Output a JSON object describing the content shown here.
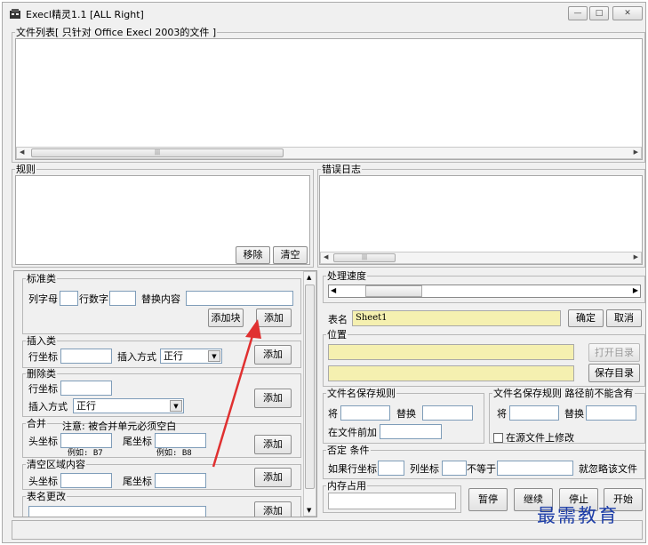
{
  "window": {
    "title": "Execl精灵1.1  [ALL Right]",
    "minimize_label": "—",
    "maximize_label": "□",
    "close_label": "✕"
  },
  "file_list": {
    "legend": "文件列表[ 只针对 Office Execl 2003的文件 ]"
  },
  "rules": {
    "legend": "规则",
    "remove_label": "移除",
    "clear_label": "清空"
  },
  "error_log": {
    "legend": "错误日志"
  },
  "standard": {
    "legend": "标准类",
    "col_letter_label": "列字母",
    "row_number_label": "行数字",
    "replace_label": "替换内容",
    "add_quick_label": "添加块",
    "add_label": "添加"
  },
  "insert": {
    "legend": "插入类",
    "row_coord_label": "行坐标",
    "mode_label": "插入方式",
    "mode_value": "正行",
    "add_label": "添加"
  },
  "delete": {
    "legend": "删除类",
    "row_coord_label": "行坐标",
    "mode_label": "插入方式",
    "mode_value": "正行",
    "add_label": "添加"
  },
  "merge": {
    "legend": "合并",
    "note": "注意: 被合并单元必须空白",
    "head_label": "头坐标",
    "tail_label": "尾坐标",
    "example1": "例如: B7",
    "example2": "例如: B8",
    "add_label": "添加"
  },
  "clear_area": {
    "legend": "清空区域内容",
    "head_label": "头坐标",
    "tail_label": "尾坐标",
    "add_label": "添加"
  },
  "sheet_rename": {
    "legend": "表名更改",
    "add_label": "添加"
  },
  "progress": {
    "legend": "处理速度",
    "level": 0.1
  },
  "sheet": {
    "label": "表名",
    "value": "Sheet1",
    "ok_label": "确定",
    "cancel_label": "取消"
  },
  "location": {
    "legend": "位置",
    "open_dir_label": "打开目录",
    "save_dir_label": "保存目录"
  },
  "filename_rule1": {
    "legend": "文件名保存规则",
    "will_label": "将",
    "replace_label": "替换",
    "prefix_label": "在文件前加"
  },
  "filename_rule2": {
    "legend": "文件名保存规则  路径前不能含有",
    "will_label": "将",
    "replace_label": "替换",
    "modify_source_label": "在源文件上修改"
  },
  "negate": {
    "legend": "否定 条件",
    "if_row_label": "如果行坐标",
    "col_label": "列坐标",
    "not_equal_label": "不等于",
    "ignore_label": "就忽略该文件"
  },
  "memory": {
    "legend": "内存占用"
  },
  "controls": {
    "pause_label": "暂停",
    "continue_label": "继续",
    "stop_label": "停止",
    "start_label": "开始"
  },
  "watermark": "最需教育"
}
